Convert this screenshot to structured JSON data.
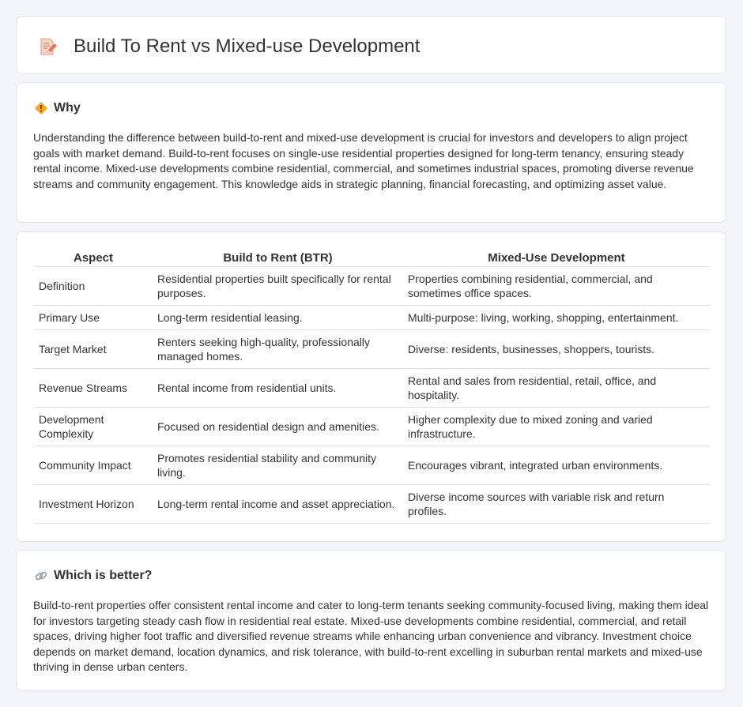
{
  "header": {
    "title": "Build To Rent vs Mixed-use Development",
    "icon": "document-pencil-icon"
  },
  "why": {
    "heading": "Why",
    "icon": "diamond-warning-icon",
    "text": "Understanding the difference between build-to-rent and mixed-use development is crucial for investors and developers to align project goals with market demand. Build-to-rent focuses on single-use residential properties designed for long-term tenancy, ensuring steady rental income. Mixed-use developments combine residential, commercial, and sometimes industrial spaces, promoting diverse revenue streams and community engagement. This knowledge aids in strategic planning, financial forecasting, and optimizing asset value."
  },
  "table": {
    "headers": [
      "Aspect",
      "Build to Rent (BTR)",
      "Mixed-Use Development"
    ],
    "rows": [
      [
        "Definition",
        "Residential properties built specifically for rental purposes.",
        "Properties combining residential, commercial, and sometimes office spaces."
      ],
      [
        "Primary Use",
        "Long-term residential leasing.",
        "Multi-purpose: living, working, shopping, entertainment."
      ],
      [
        "Target Market",
        "Renters seeking high-quality, professionally managed homes.",
        "Diverse: residents, businesses, shoppers, tourists."
      ],
      [
        "Revenue Streams",
        "Rental income from residential units.",
        "Rental and sales from residential, retail, office, and hospitality."
      ],
      [
        "Development Complexity",
        "Focused on residential design and amenities.",
        "Higher complexity due to mixed zoning and varied infrastructure."
      ],
      [
        "Community Impact",
        "Promotes residential stability and community living.",
        "Encourages vibrant, integrated urban environments."
      ],
      [
        "Investment Horizon",
        "Long-term rental income and asset appreciation.",
        "Diverse income sources with variable risk and return profiles."
      ]
    ]
  },
  "better": {
    "heading": "Which is better?",
    "icon": "link-icon",
    "text": "Build-to-rent properties offer consistent rental income and cater to long-term tenants seeking community-focused living, making them ideal for investors targeting steady cash flow in residential real estate. Mixed-use developments combine residential, commercial, and retail spaces, driving higher foot traffic and diversified revenue streams while enhancing urban convenience and vibrancy. Investment choice depends on market demand, location dynamics, and risk tolerance, with build-to-rent excelling in suburban rental markets and mixed-use thriving in dense urban centers."
  }
}
